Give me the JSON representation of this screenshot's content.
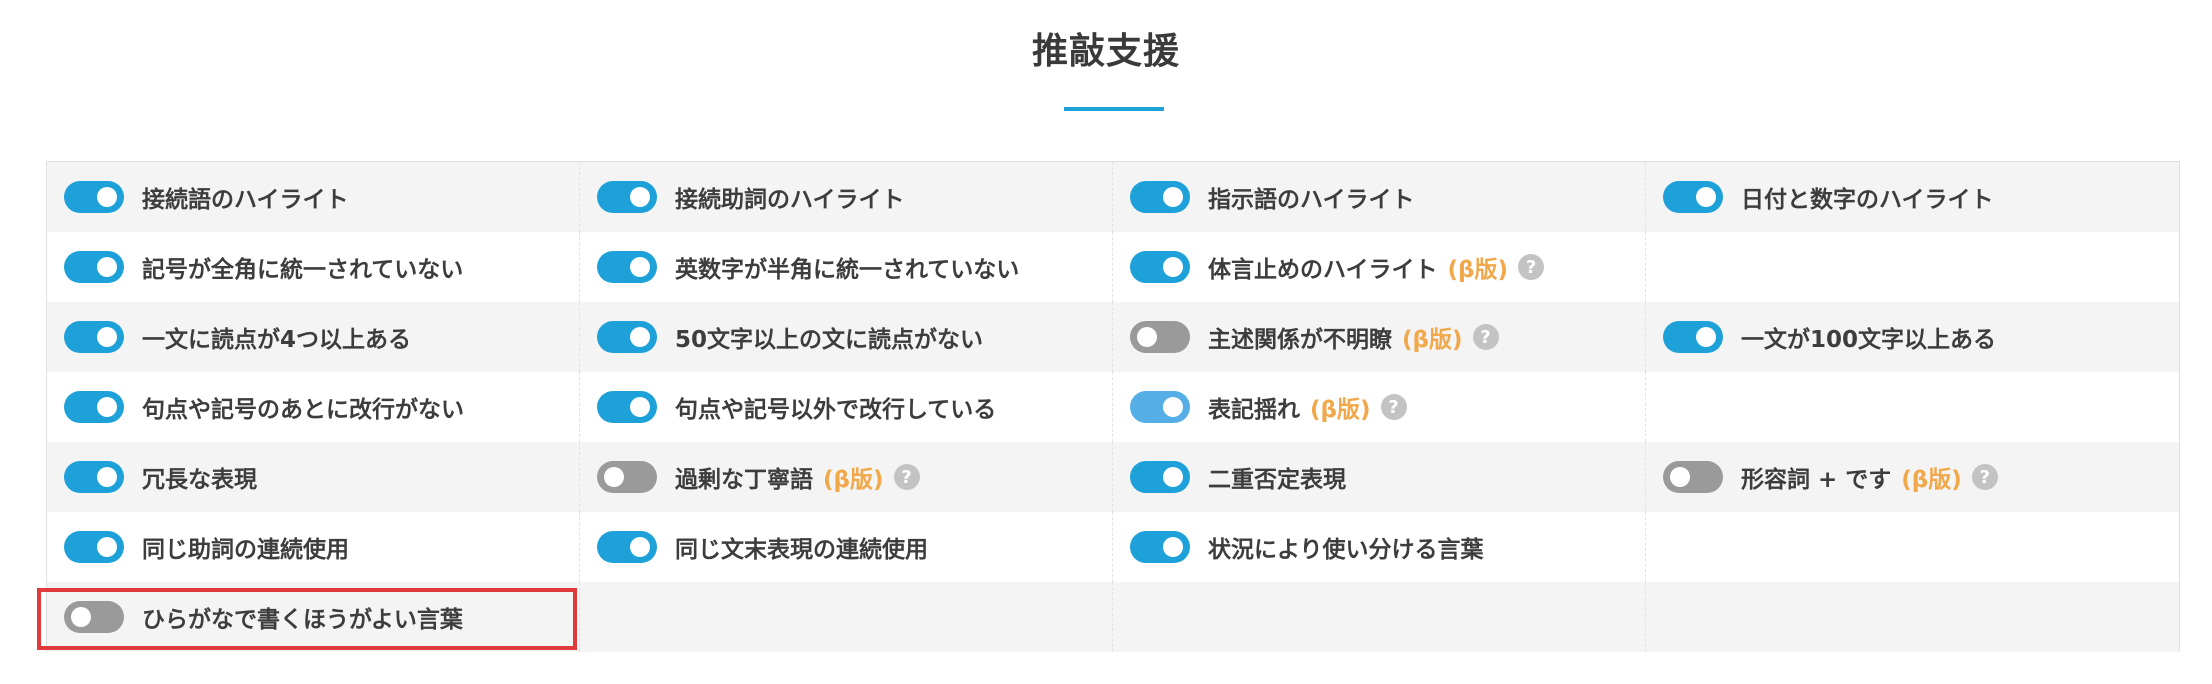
{
  "page": {
    "title": "推敲支援"
  },
  "colors": {
    "accent": "#1ea1d9",
    "beta": "#f0a84a",
    "off": "#9a9a9a",
    "highlight": "#e03a3a"
  },
  "beta_label": "(β版)",
  "help_glyph": "?",
  "rows": [
    [
      {
        "label": "接続語のハイライト",
        "enabled": true
      },
      {
        "label": "接続助詞のハイライト",
        "enabled": true
      },
      {
        "label": "指示語のハイライト",
        "enabled": true
      },
      {
        "label": "日付と数字のハイライト",
        "enabled": true
      }
    ],
    [
      {
        "label": "記号が全角に統一されていない",
        "enabled": true
      },
      {
        "label": "英数字が半角に統一されていない",
        "enabled": true
      },
      {
        "label": "体言止めのハイライト",
        "enabled": true,
        "beta": true,
        "help": true
      },
      null
    ],
    [
      {
        "label": "一文に読点が4つ以上ある",
        "enabled": true
      },
      {
        "label": "50文字以上の文に読点がない",
        "enabled": true
      },
      {
        "label": "主述関係が不明瞭",
        "enabled": false,
        "beta": true,
        "help": true
      },
      {
        "label": "一文が100文字以上ある",
        "enabled": true
      }
    ],
    [
      {
        "label": "句点や記号のあとに改行がない",
        "enabled": true
      },
      {
        "label": "句点や記号以外で改行している",
        "enabled": true
      },
      {
        "label": "表記揺れ",
        "enabled": true,
        "beta": true,
        "help": true,
        "light": true
      },
      null
    ],
    [
      {
        "label": "冗長な表現",
        "enabled": true
      },
      {
        "label": "過剰な丁寧語",
        "enabled": false,
        "beta": true,
        "help": true
      },
      {
        "label": "二重否定表現",
        "enabled": true
      },
      {
        "label": "形容詞 + です",
        "enabled": false,
        "beta": true,
        "help": true
      }
    ],
    [
      {
        "label": "同じ助詞の連続使用",
        "enabled": true
      },
      {
        "label": "同じ文末表現の連続使用",
        "enabled": true
      },
      {
        "label": "状況により使い分ける言葉",
        "enabled": true
      },
      null
    ],
    [
      {
        "label": "ひらがなで書くほうがよい言葉",
        "enabled": false,
        "highlighted": true
      },
      null,
      null,
      null
    ]
  ]
}
